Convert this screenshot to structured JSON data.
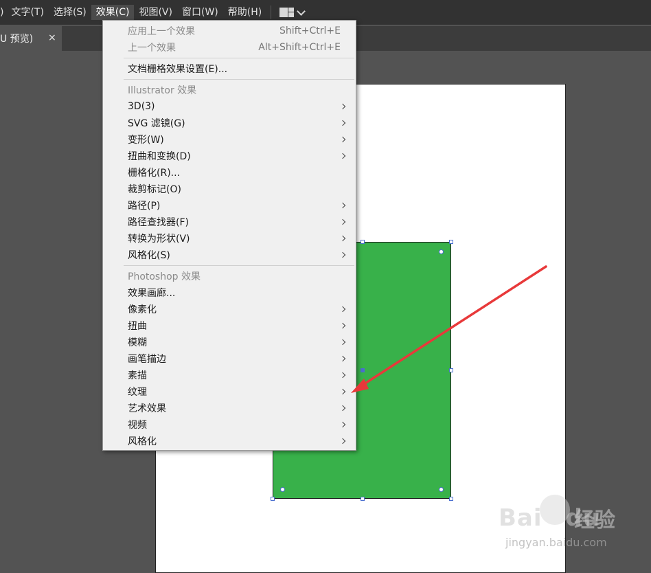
{
  "menubar": {
    "items": [
      {
        "label": ")",
        "name": "menu-prev-partial"
      },
      {
        "label": "文字(T)",
        "name": "menu-text"
      },
      {
        "label": "选择(S)",
        "name": "menu-select"
      },
      {
        "label": "效果(C)",
        "name": "menu-effect"
      },
      {
        "label": "视图(V)",
        "name": "menu-view"
      },
      {
        "label": "窗口(W)",
        "name": "menu-window"
      },
      {
        "label": "帮助(H)",
        "name": "menu-help"
      }
    ],
    "workspace_icon": "workspace-layout-icon"
  },
  "tabs": {
    "doc_label": "U 预览)",
    "close_glyph": "×"
  },
  "effect_menu": {
    "items": [
      {
        "label": "应用上一个效果",
        "shortcut": "Shift+Ctrl+E",
        "type": "disabled"
      },
      {
        "label": "上一个效果",
        "shortcut": "Alt+Shift+Ctrl+E",
        "type": "disabled"
      },
      {
        "type": "separator"
      },
      {
        "label": "文档栅格效果设置(E)...",
        "type": "item"
      },
      {
        "type": "separator"
      },
      {
        "label": "Illustrator 效果",
        "type": "header"
      },
      {
        "label": "3D(3)",
        "type": "submenu"
      },
      {
        "label": "SVG 滤镜(G)",
        "type": "submenu"
      },
      {
        "label": "变形(W)",
        "type": "submenu"
      },
      {
        "label": "扭曲和变换(D)",
        "type": "submenu"
      },
      {
        "label": "栅格化(R)...",
        "type": "item"
      },
      {
        "label": "裁剪标记(O)",
        "type": "item"
      },
      {
        "label": "路径(P)",
        "type": "submenu"
      },
      {
        "label": "路径查找器(F)",
        "type": "submenu"
      },
      {
        "label": "转换为形状(V)",
        "type": "submenu"
      },
      {
        "label": "风格化(S)",
        "type": "submenu"
      },
      {
        "type": "separator"
      },
      {
        "label": "Photoshop 效果",
        "type": "header"
      },
      {
        "label": "效果画廊...",
        "type": "item"
      },
      {
        "label": "像素化",
        "type": "submenu"
      },
      {
        "label": "扭曲",
        "type": "submenu"
      },
      {
        "label": "模糊",
        "type": "submenu"
      },
      {
        "label": "画笔描边",
        "type": "submenu"
      },
      {
        "label": "素描",
        "type": "submenu"
      },
      {
        "label": "纹理",
        "type": "submenu"
      },
      {
        "label": "艺术效果",
        "type": "submenu"
      },
      {
        "label": "视频",
        "type": "submenu"
      },
      {
        "label": "风格化",
        "type": "submenu"
      }
    ]
  },
  "canvas": {
    "shape_fill": "#38b14a",
    "selection_color": "#4a6fd0",
    "annotation_arrow_color": "#e8393a"
  },
  "watermark": {
    "brand": "Bai",
    "brand_tail": "du",
    "product": "经验",
    "url": "jingyan.baidu.com"
  }
}
